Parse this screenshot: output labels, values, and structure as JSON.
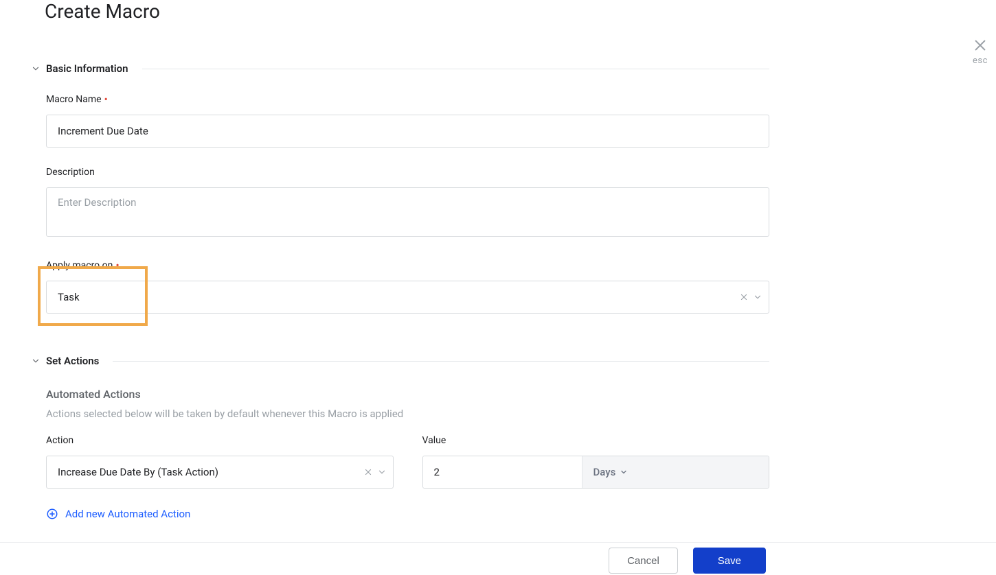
{
  "close": {
    "esc_label": "esc"
  },
  "page_title": "Create Macro",
  "sections": {
    "basic": {
      "title": "Basic Information",
      "macro_name": {
        "label": "Macro Name",
        "value": "Increment Due Date"
      },
      "description": {
        "label": "Description",
        "placeholder": "Enter Description",
        "value": ""
      },
      "apply_on": {
        "label": "Apply macro on",
        "value": "Task"
      }
    },
    "actions": {
      "title": "Set Actions",
      "automated_heading": "Automated Actions",
      "automated_desc": "Actions selected below will be taken by default whenever this Macro is applied",
      "action": {
        "label": "Action",
        "value": "Increase Due Date By (Task Action)"
      },
      "value": {
        "label": "Value",
        "number": "2",
        "unit": "Days"
      },
      "add_link": "Add new Automated Action"
    }
  },
  "footer": {
    "cancel": "Cancel",
    "save": "Save"
  }
}
